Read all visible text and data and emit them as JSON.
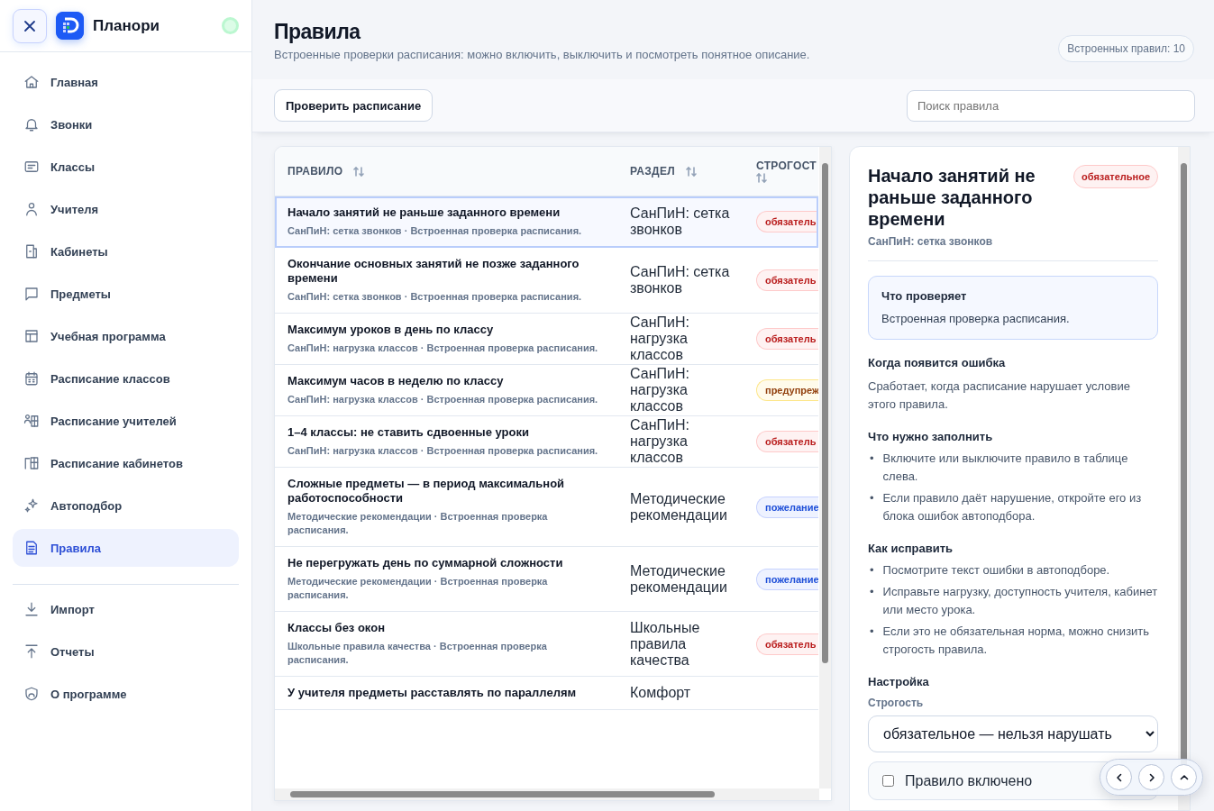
{
  "sidebar": {
    "app_name": "Планори",
    "online": true,
    "items": [
      {
        "label": "Главная",
        "selected": false
      },
      {
        "label": "Звонки",
        "selected": false
      },
      {
        "label": "Классы",
        "selected": false
      },
      {
        "label": "Учителя",
        "selected": false
      },
      {
        "label": "Кабинеты",
        "selected": false
      },
      {
        "label": "Предметы",
        "selected": false
      },
      {
        "label": "Учебная программа",
        "selected": false
      },
      {
        "label": "Расписание классов",
        "selected": false
      },
      {
        "label": "Расписание учителей",
        "selected": false
      },
      {
        "label": "Расписание кабинетов",
        "selected": false
      },
      {
        "label": "Автоподбор",
        "selected": false
      },
      {
        "label": "Правила",
        "selected": true
      }
    ],
    "footer_items": [
      {
        "label": "Импорт",
        "selected": false
      },
      {
        "label": "Отчеты",
        "selected": false
      },
      {
        "label": "О программе",
        "selected": false
      }
    ]
  },
  "page": {
    "title": "Правила",
    "subtitle": "Встроенные проверки расписания: можно включить, выключить и посмотреть понятное описание.",
    "rule_count": "Встроенных правил: 10"
  },
  "toolbar": {
    "check_button": "Проверить расписание",
    "search": {
      "placeholder": "Поиск правила"
    }
  },
  "table": {
    "columns": [
      "ПРАВИЛО",
      "РАЗДЕЛ",
      "СТРОГОСТ"
    ],
    "rows": [
      {
        "title": "Начало занятий не раньше заданного времени",
        "meta": "СанПиН: сетка звонков · Встроенная проверка расписания.",
        "section": "СанПиН: сетка звонков",
        "severity": {
          "label": "обязатель",
          "kind": "required"
        },
        "selected": true
      },
      {
        "title": "Окончание основных занятий не позже заданного времени",
        "meta": "СанПиН: сетка звонков · Встроенная проверка расписания.",
        "section": "СанПиН: сетка звонков",
        "severity": {
          "label": "обязатель",
          "kind": "required"
        },
        "selected": false
      },
      {
        "title": "Максимум уроков в день по классу",
        "meta": "СанПиН: нагрузка классов · Встроенная проверка расписания.",
        "section": "СанПиН: нагрузка классов",
        "severity": {
          "label": "обязатель",
          "kind": "required"
        },
        "selected": false
      },
      {
        "title": "Максимум часов в неделю по классу",
        "meta": "СанПиН: нагрузка классов · Встроенная проверка расписания.",
        "section": "СанПиН: нагрузка классов",
        "severity": {
          "label": "предупреж",
          "kind": "warning"
        },
        "selected": false
      },
      {
        "title": "1–4 классы: не ставить сдвоенные уроки",
        "meta": "СанПиН: нагрузка классов · Встроенная проверка расписания.",
        "section": "СанПиН: нагрузка классов",
        "severity": {
          "label": "обязатель",
          "kind": "required"
        },
        "selected": false
      },
      {
        "title": "Сложные предметы — в период максимальной работоспособности",
        "meta": "Методические рекомендации · Встроенная проверка расписания.",
        "section": "Методические рекомендации",
        "severity": {
          "label": "пожелание",
          "kind": "wish"
        },
        "selected": false
      },
      {
        "title": "Не перегружать день по суммарной сложности",
        "meta": "Методические рекомендации · Встроенная проверка расписания.",
        "section": "Методические рекомендации",
        "severity": {
          "label": "пожелание",
          "kind": "wish"
        },
        "selected": false
      },
      {
        "title": "Классы без окон",
        "meta": "Школьные правила качества · Встроенная проверка расписания.",
        "section": "Школьные правила качества",
        "severity": {
          "label": "обязатель",
          "kind": "required"
        },
        "selected": false
      },
      {
        "title": "У учителя предметы расставлять по параллелям",
        "section": "Комфорт",
        "selected": false
      }
    ]
  },
  "detail": {
    "title": "Начало занятий не раньше заданного времени",
    "severity": {
      "label": "обязательное",
      "kind": "required"
    },
    "section": "СанПиН: сетка звонков",
    "what_checks": {
      "heading": "Что проверяет",
      "text": "Встроенная проверка расписания."
    },
    "sections": [
      {
        "kind": "text",
        "heading": "Когда появится ошибка",
        "text": "Сработает, когда расписание нарушает условие этого правила."
      },
      {
        "kind": "list",
        "heading": "Что нужно заполнить",
        "marker": "•",
        "items": [
          "Включите или выключите правило в таблице слева.",
          "Если правило даёт нарушение, откройте его из блока ошибок автоподбора."
        ]
      },
      {
        "kind": "list",
        "heading": "Как исправить",
        "marker": "•",
        "items": [
          "Посмотрите текст ошибки в автоподборе.",
          "Исправьте нагрузку, доступность учителя, кабинет или место урока.",
          "Если это не обязательная норма, можно снизить строгость правила."
        ]
      }
    ],
    "settings": {
      "heading": "Настройка",
      "severity_label": "Строгость",
      "severity_value": "обязательное — нельзя нарушать",
      "enabled_label": "Правило включено",
      "enabled": false
    }
  }
}
